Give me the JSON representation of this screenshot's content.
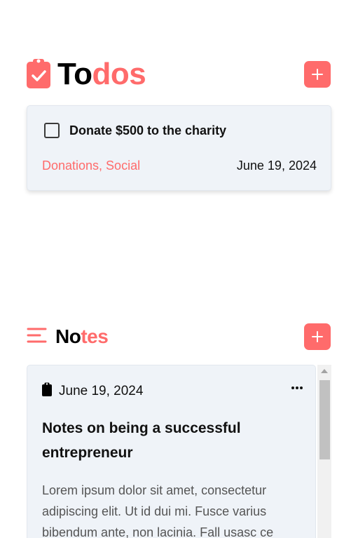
{
  "todos": {
    "title_main": "To",
    "title_accent": "dos",
    "icon": "clipboard-check-icon",
    "add_icon": "plus-icon",
    "items": [
      {
        "text": "Donate $500 to the charity",
        "checked": false,
        "tags": "Donations, Social",
        "date": "June 19, 2024"
      }
    ]
  },
  "notes": {
    "title_main": "No",
    "title_accent": "tes",
    "icon": "menu-lines-icon",
    "add_icon": "plus-icon",
    "items": [
      {
        "date": "June 19, 2024",
        "date_icon": "clipboard-icon",
        "menu_icon": "more-horizontal-icon",
        "title": "Notes on being a successful entrepreneur",
        "body": "Lorem ipsum dolor sit amet, consectetur adipiscing elit. Ut id dui mi. Fusce varius bibendum ante, non lacinia. Fall usasc ce"
      }
    ]
  },
  "colors": {
    "accent": "#ff6b6b",
    "card_bg": "#eff3f8",
    "text": "#111111",
    "muted": "#555555"
  }
}
